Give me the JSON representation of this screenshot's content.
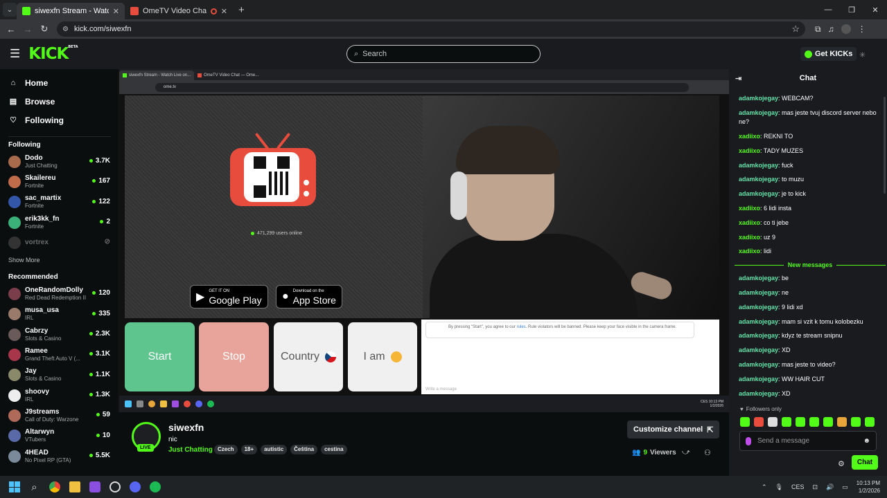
{
  "browser": {
    "tabs": [
      {
        "title": "siwexfn Stream - Watch Live on Kick",
        "active": true
      },
      {
        "title": "OmeTV Video Chat — Omegle",
        "active": false
      }
    ],
    "url": "kick.com/siwexfn"
  },
  "header": {
    "logo": "KICK",
    "logo_beta": "BETA",
    "search_placeholder": "Search",
    "get_kicks": "Get KICKs"
  },
  "nav": [
    {
      "label": "Home",
      "icon": "home-icon"
    },
    {
      "label": "Browse",
      "icon": "browse-icon"
    },
    {
      "label": "Following",
      "icon": "heart-icon"
    }
  ],
  "following_title": "Following",
  "following": [
    {
      "name": "Dodo",
      "category": "Just Chatting",
      "viewers": "3.7K",
      "color": "#a86b4c"
    },
    {
      "name": "Skailereu",
      "category": "Fortnite",
      "viewers": "167",
      "color": "#c06c4a"
    },
    {
      "name": "sac_martix",
      "category": "Fortnite",
      "viewers": "122",
      "color": "#3456a8"
    },
    {
      "name": "erik3kk_fn",
      "category": "Fortnite",
      "viewers": "2",
      "color": "#3bb078"
    },
    {
      "name": "vortrex",
      "category": "",
      "viewers": "",
      "color": "#333333",
      "offline": true
    }
  ],
  "show_more": "Show More",
  "recommended_title": "Recommended",
  "recommended": [
    {
      "name": "OneRandomDolly",
      "category": "Red Dead Redemption II",
      "viewers": "120",
      "color": "#7a3d4a"
    },
    {
      "name": "musa_usa",
      "category": "IRL",
      "viewers": "335",
      "color": "#9a7a6a"
    },
    {
      "name": "Cabrzy",
      "category": "Slots & Casino",
      "viewers": "2.3K",
      "color": "#6a5a5a"
    },
    {
      "name": "Ramee",
      "category": "Grand Theft Auto V (...",
      "viewers": "3.1K",
      "color": "#a8364a"
    },
    {
      "name": "Jay",
      "category": "Slots & Casino",
      "viewers": "1.1K",
      "color": "#8a8a6a"
    },
    {
      "name": "shoovy",
      "category": "IRL",
      "viewers": "1.3K",
      "color": "#eeeeee"
    },
    {
      "name": "J9streams",
      "category": "Call of Duty: Warzone",
      "viewers": "59",
      "color": "#b06a5a"
    },
    {
      "name": "Altarwyn",
      "category": "VTubers",
      "viewers": "10",
      "color": "#5a6aa8"
    },
    {
      "name": "4HEAD",
      "category": "No Pixel RP (GTA)",
      "viewers": "5.5K",
      "color": "#7a8a9a"
    }
  ],
  "inner": {
    "tab1": "siwexfn Stream - Watch Live on...",
    "tab2": "OmeTV Video Chat — Ome...",
    "url": "ome.tv",
    "users_online": "471,299 users online",
    "google_small": "GET IT ON",
    "google_big": "Google Play",
    "apple_small": "Download on the",
    "apple_big": "App Store",
    "start": "Start",
    "stop": "Stop",
    "country": "Country",
    "iam": "I am",
    "notice_pre": "By pressing \"Start\", you agree to our ",
    "notice_link": "rules",
    "notice_post": ". Rule violators will be banned. Please keep your face visible in the camera frame.",
    "write": "Write a message",
    "clock_time": "10:13 PM",
    "clock_date": "1/2/2026",
    "lang": "CES"
  },
  "stream": {
    "name": "siwexfn",
    "title": "nic",
    "category": "Just Chatting",
    "tags": [
      "Czech",
      "18+",
      "autistic",
      "Čeština",
      "cestina"
    ],
    "live": "LIVE",
    "customize": "Customize channel",
    "viewers_num": "9",
    "viewers_label": "Viewers"
  },
  "chat": {
    "title": "Chat",
    "messages_before": [
      {
        "user": "adamkojegay",
        "text": "WEBCAM?",
        "color": "#62e3a8"
      },
      {
        "user": "adamkojegay",
        "text": "mas jeste tvuj discord server nebo ne?",
        "color": "#62e3a8"
      },
      {
        "user": "xadiixo",
        "text": "REKNI TO",
        "color": "#53fc18"
      },
      {
        "user": "xadiixo",
        "text": "TADY MUZES",
        "color": "#53fc18"
      },
      {
        "user": "adamkojegay",
        "text": "fuck",
        "color": "#62e3a8"
      },
      {
        "user": "adamkojegay",
        "text": "to muzu",
        "color": "#62e3a8"
      },
      {
        "user": "adamkojegay",
        "text": "je to kick",
        "color": "#62e3a8"
      },
      {
        "user": "xadiixo",
        "text": "6 lidi insta",
        "color": "#53fc18"
      },
      {
        "user": "xadiixo",
        "text": "co ti jebe",
        "color": "#53fc18"
      },
      {
        "user": "xadiixo",
        "text": "uz 9",
        "color": "#53fc18"
      },
      {
        "user": "xadiixo",
        "text": "lidi",
        "color": "#53fc18"
      }
    ],
    "new_messages": "New messages",
    "messages_after": [
      {
        "user": "adamkojegay",
        "text": "be",
        "color": "#62e3a8"
      },
      {
        "user": "adamkojegay",
        "text": "ne",
        "color": "#62e3a8"
      },
      {
        "user": "adamkojegay",
        "text": "9 lidi xd",
        "color": "#62e3a8"
      },
      {
        "user": "adamkojegay",
        "text": "mam si vzit k tomu kolobezku",
        "color": "#62e3a8"
      },
      {
        "user": "adamkojegay",
        "text": "kdyz te stream snipnu",
        "color": "#62e3a8"
      },
      {
        "user": "adamkojegay",
        "text": "XD",
        "color": "#62e3a8"
      },
      {
        "user": "adamkojegay",
        "text": "mas jeste to video?",
        "color": "#62e3a8"
      },
      {
        "user": "adamkojegay",
        "text": "WW HAIR CUT",
        "color": "#62e3a8"
      },
      {
        "user": "adamkojegay",
        "text": "XD",
        "color": "#62e3a8"
      }
    ],
    "followers_only": "Followers only",
    "send_placeholder": "Send a message",
    "chat_button": "Chat"
  },
  "taskbar": {
    "lang": "CES",
    "time": "10:13 PM",
    "date": "1/2/2026"
  },
  "colors": {
    "accent": "#53fc18",
    "background": "#0b0e0f",
    "panel": "#191b1f"
  }
}
